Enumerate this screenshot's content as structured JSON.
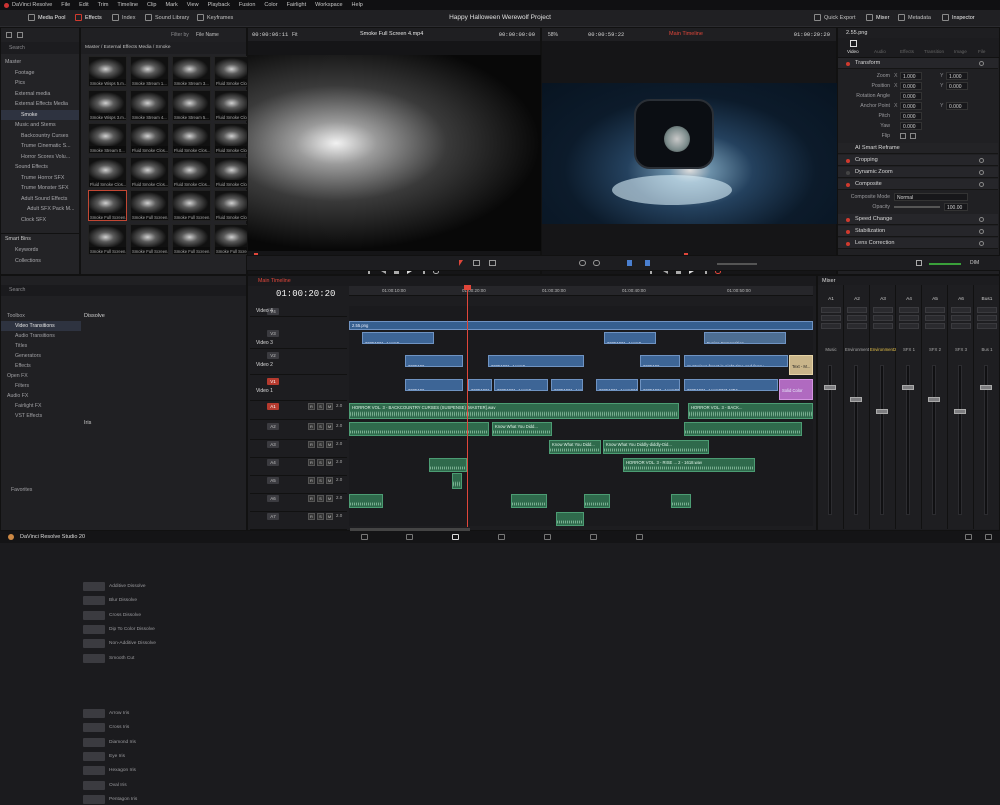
{
  "menubar": {
    "items": [
      "DaVinci Resolve",
      "File",
      "Edit",
      "Trim",
      "Timeline",
      "Clip",
      "Mark",
      "View",
      "Playback",
      "Fusion",
      "Color",
      "Fairlight",
      "Workspace",
      "Help"
    ]
  },
  "toolbar": {
    "left": [
      "Media Pool",
      "Effects",
      "Index",
      "Sound Library",
      "Keyframes"
    ],
    "project_title": "Happy Halloween Werewolf Project",
    "right": [
      "Quick Export",
      "Mixer",
      "Metadata",
      "Inspector"
    ]
  },
  "source_viewer": {
    "left_tc": "00:00:06:11",
    "fit": "Fit",
    "clip_name": "Smoke Full Screen 4.mp4",
    "right_tc": "00:00:00:00"
  },
  "timeline_viewer": {
    "zoom": "58%",
    "left_tc": "00:00:59:22",
    "name": "Main Timeline",
    "right_tc": "01:00:20:20"
  },
  "inspector": {
    "file": "2.55.png",
    "tabs": [
      "Video",
      "Audio",
      "Effects",
      "Transition",
      "Image",
      "File"
    ],
    "sections": [
      "Transform",
      "AI Smart Reframe",
      "Cropping",
      "Dynamic Zoom",
      "Composite",
      "Speed Change",
      "Stabilization",
      "Lens Correction"
    ],
    "transform": {
      "zoom_label": "Zoom",
      "zoom_x": "1.000",
      "zoom_y": "1.000",
      "position_label": "Position",
      "pos_x": "0.000",
      "pos_y": "0.000",
      "rotation_label": "Rotation Angle",
      "rotation": "0.000",
      "anchor_label": "Anchor Point",
      "anchor_x": "0.000",
      "anchor_y": "0.000",
      "pitch_label": "Pitch",
      "pitch": "0.000",
      "yaw_label": "Yaw",
      "yaw": "0.000",
      "flip_label": "Flip"
    },
    "composite": {
      "mode_label": "Composite Mode",
      "mode": "Normal",
      "opacity_label": "Opacity",
      "opacity": "100.00"
    }
  },
  "media_pool": {
    "bins": [
      "Master",
      "Footage",
      "Pics",
      "External media",
      "External Effects Media",
      "Smoke",
      "Music and Stems",
      "Backcountry Curses",
      "Trume Cinematic S...",
      "Horror Scores Volu...",
      "Sound Effects",
      "Trume Horror SFX",
      "Trume Monster SFX",
      "Adult Sound Effects",
      "Adult SFX Pack M...",
      "Clock SFX"
    ],
    "smart_bins_label": "Smart Bins",
    "smart_bins": [
      "Keywords",
      "Collections"
    ],
    "path": "Master / External Effects Media / Smoke",
    "search_placeholder": "Search",
    "filter_label": "Filter by",
    "filter_value": "File Name",
    "thumbnails": [
      "Smoke Wisps 5.m...",
      "Smoke Stream 1...",
      "Smoke Stream 3...",
      "Fluid Smoke Clos...",
      "Smoke Wisps 3.m...",
      "Smoke Stream 4...",
      "Smoke Stream 5...",
      "Fluid Smoke Clos...",
      "Smoke Stream 0...",
      "Fluid Smoke Clos...",
      "Fluid Smoke Clos...",
      "Fluid Smoke Clos...",
      "Fluid Smoke Clos...",
      "Fluid Smoke Clos...",
      "Fluid Smoke Clos...",
      "Fluid Smoke Clos...",
      "Smoke Full Screen...",
      "Smoke Full Screen...",
      "Smoke Full Screen...",
      "Fluid Smoke Clos...",
      "Smoke Full Screen...",
      "Smoke Full Screen...",
      "Smoke Full Screen...",
      "Smoke Full Screen..."
    ]
  },
  "effects": {
    "search_placeholder": "Search",
    "tree": [
      "Toolbox",
      "Video Transitions",
      "Audio Transitions",
      "Titles",
      "Generators",
      "Effects",
      "Open FX",
      "Filters",
      "Audio FX",
      "Fairlight FX",
      "VST Effects"
    ],
    "favorites": "Favorites",
    "dissolve_header": "Dissolve",
    "dissolve": [
      "Additive Dissolve",
      "Blur Dissolve",
      "Cross Dissolve",
      "Dip To Color Dissolve",
      "Non-Additive Dissolve",
      "Smooth Cut"
    ],
    "iris_header": "Iris",
    "iris": [
      "Arrow Iris",
      "Cross Iris",
      "Diamond Iris",
      "Eye Iris",
      "Hexagon Iris",
      "Oval Iris",
      "Pentagon Iris"
    ]
  },
  "timeline": {
    "tab": "Main Timeline",
    "timecode": "01:00:20:20",
    "ruler": [
      "01:00:10:00",
      "01:00:20:00",
      "01:00:30:00",
      "01:00:40:00",
      "01:00:50:00"
    ],
    "tracks": [
      {
        "id": "V4",
        "name": "Video 4",
        "clips": 0
      },
      {
        "id": "V3",
        "name": "Video 3",
        "clips": 0
      },
      {
        "id": "V2",
        "name": "Video 2",
        "clips": 0
      },
      {
        "id": "V1",
        "name": "Video 1",
        "clips": 0
      },
      {
        "id": "A1",
        "name": "",
        "vol": "2.0"
      },
      {
        "id": "A2",
        "name": "",
        "vol": "2.0"
      },
      {
        "id": "A3",
        "name": "",
        "vol": "2.0"
      },
      {
        "id": "A4",
        "name": "",
        "vol": "2.0"
      },
      {
        "id": "A5",
        "name": "",
        "vol": "2.0"
      },
      {
        "id": "A6",
        "name": "",
        "vol": "2.0"
      },
      {
        "id": "A7",
        "name": "",
        "vol": "2.0"
      }
    ],
    "clip_labels": {
      "v4": "2.55.png",
      "v3a": "20251021_Acam0...",
      "v3b": "20251021_Acam0...",
      "v3c": "Fusion Composition",
      "v2a": "2025102...",
      "v2b": "20251021_Acam0...",
      "v2c": "mysterious-forest-in-night-time-and-foggy-...",
      "v2d": "Text - M...",
      "v1a": "2025102...",
      "v1b": "20251021_Acam0...",
      "v1c": "20251021_Acam0214.MP4",
      "v1d": "20251021_Acam0221.MP4",
      "v1e": "Solid Color",
      "a1a": "HORROR VOL. 3 - BACKCOUNTRY CURSES (SUSPENSE) [MASTER].wav",
      "a1b": "HORROR VOL. 3 - BACK...",
      "a2a": "Know What You Didd...",
      "a2b": "Know What You Didd...",
      "a3a": "Know What You Diddly-diddly-Did...",
      "a4a": "HORROR VOL. 3 - RISE ... 2 - 1618.wav"
    }
  },
  "mixer": {
    "title": "Mixer",
    "channels": [
      "A1",
      "A2",
      "A3",
      "A4",
      "A5",
      "A6",
      "Bus1"
    ],
    "names": [
      "Music",
      "Environment",
      "Environment2",
      "SFX 1",
      "SFX 2",
      "SFX 3",
      "Bus 1"
    ]
  },
  "transport": {
    "dim_label": "DIM"
  },
  "app_footer": {
    "name": "DaVinci Resolve Studio 20"
  },
  "colors": {
    "accent": "#d03a2e",
    "video_clip": "#3d6596",
    "audio_clip": "#2f6a4c",
    "playhead": "#e0463a"
  }
}
